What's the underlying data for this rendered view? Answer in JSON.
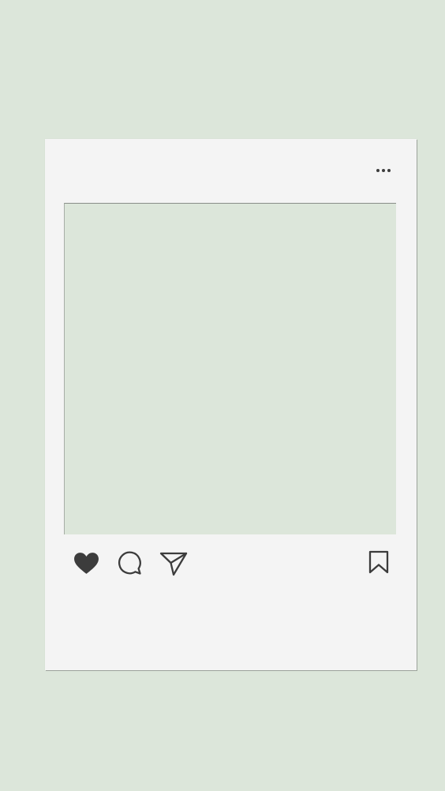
{
  "colors": {
    "background": "#dce6da",
    "card": "#f4f4f4",
    "photo_placeholder": "#dce6da",
    "icon": "#3c3c3c"
  },
  "post": {
    "header": {
      "more_icon": "more-horizontal-icon"
    },
    "actions": {
      "like_icon": "heart-filled-icon",
      "comment_icon": "comment-bubble-icon",
      "share_icon": "paper-plane-icon",
      "save_icon": "bookmark-icon"
    }
  }
}
